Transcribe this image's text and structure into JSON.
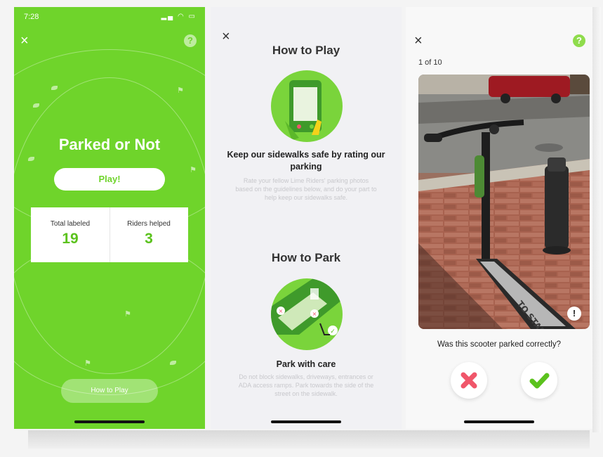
{
  "screens": {
    "intro": {
      "status_time": "7:28",
      "title": "Parked or Not",
      "play_label": "Play!",
      "stats": [
        {
          "label": "Total labeled",
          "value": "19"
        },
        {
          "label": "Riders helped",
          "value": "3"
        }
      ],
      "how_to_play_label": "How to Play"
    },
    "instructions": {
      "sections": [
        {
          "heading": "How to Play",
          "subheading": "Keep our sidewalks safe by rating our parking",
          "body": "Rate your fellow Lime Riders' parking photos based on the guidelines below, and do your part to help keep our sidewalks safe."
        },
        {
          "heading": "How to Park",
          "subheading": "Park with care",
          "body": "Do not block sidewalks, driveways, entrances or ADA access ramps. Park towards the side of the street on the sidewalk."
        }
      ]
    },
    "rating": {
      "progress": "1 of 10",
      "question": "Was this scooter parked correctly?",
      "deck_text": "TO START"
    }
  },
  "colors": {
    "lime_green": "#6fd42b",
    "no_red": "#f0566a",
    "yes_green": "#5bc21d"
  },
  "icons": [
    "close-icon",
    "help-icon",
    "flag-icon",
    "leaf-icon",
    "warning-icon",
    "cross-icon",
    "check-icon"
  ]
}
